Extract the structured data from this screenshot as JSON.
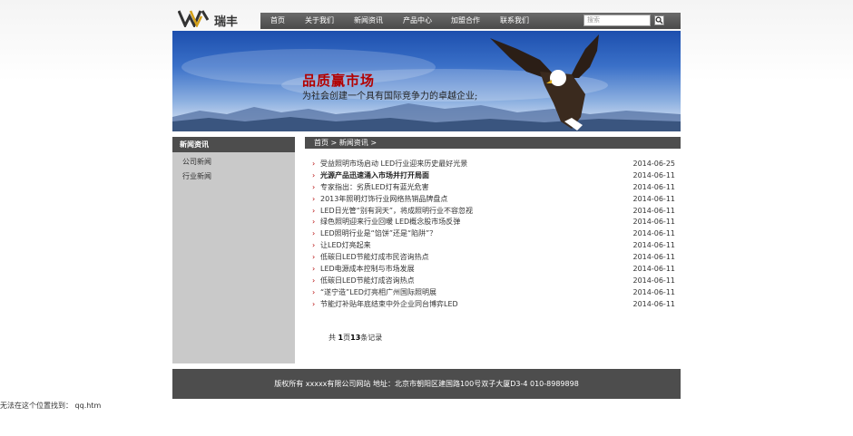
{
  "brand": {
    "logo_text": "瑞丰"
  },
  "nav": {
    "items": [
      "首页",
      "关于我们",
      "新闻资讯",
      "产品中心",
      "加盟合作",
      "联系我们"
    ],
    "search_placeholder": "搜索"
  },
  "banner": {
    "title": "品质赢市场",
    "subtitle": "为社会创建一个具有国际竞争力的卓越企业;"
  },
  "sidebar": {
    "heading": "新闻资讯",
    "items": [
      "公司新闻",
      "行业新闻"
    ]
  },
  "breadcrumb": "首页 > 新闻资讯 >",
  "news": [
    {
      "title": "受益照明市场启动 LED行业迎来历史最好光景",
      "date": "2014-06-25",
      "bold": false
    },
    {
      "title": "光源产品迅速涌入市场并打开局面",
      "date": "2014-06-11",
      "bold": true
    },
    {
      "title": "专家指出：劣质LED灯有蓝光危害",
      "date": "2014-06-11",
      "bold": false
    },
    {
      "title": "2013年照明灯饰行业网络热销品牌盘点",
      "date": "2014-06-11",
      "bold": false
    },
    {
      "title": "LED日光管“别有洞天”，将成照明行业不容忽视",
      "date": "2014-06-11",
      "bold": false
    },
    {
      "title": "绿色照明迎来行业回暖 LED概念股市场反弹",
      "date": "2014-06-11",
      "bold": false
    },
    {
      "title": "LED照明行业是“馅饼”还是“陷阱”？",
      "date": "2014-06-11",
      "bold": false
    },
    {
      "title": "让LED灯亮起来",
      "date": "2014-06-11",
      "bold": false
    },
    {
      "title": "低碳日LED节能灯成市民咨询热点",
      "date": "2014-06-11",
      "bold": false
    },
    {
      "title": "LED电源成本控制与市场发展",
      "date": "2014-06-11",
      "bold": false
    },
    {
      "title": "低碳日LED节能灯成咨询热点",
      "date": "2014-06-11",
      "bold": false
    },
    {
      "title": "“遂宁造”LED灯亮相广州国际照明展",
      "date": "2014-06-11",
      "bold": false
    },
    {
      "title": "节能灯补贴年底结束中外企业同台博弈LED",
      "date": "2014-06-11",
      "bold": false
    }
  ],
  "pager": {
    "prefix": "共",
    "page": "1",
    "middle": "页",
    "count": "13",
    "suffix": "条记录"
  },
  "footer": "版权所有 xxxxx有限公司网站 地址：北京市朝阳区建国路100号双子大厦D3-4 010-8989898",
  "error_line": "无法在这个位置找到： qq.htm",
  "colors": {
    "nav_bg": "#555555",
    "dark_bar": "#4d4d4d",
    "sidebar_bg": "#c9c9c9",
    "accent_red": "#b30000"
  }
}
